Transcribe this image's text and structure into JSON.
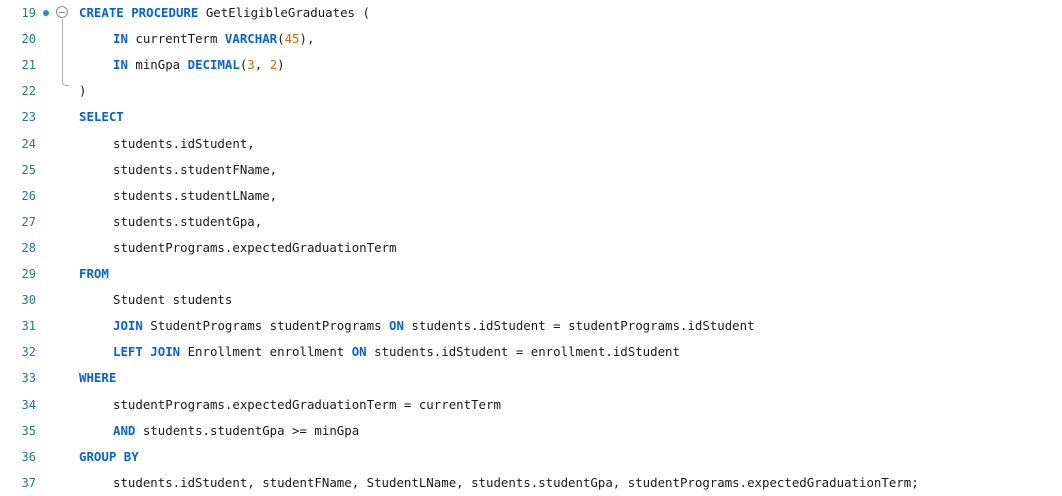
{
  "editor": {
    "colors": {
      "keyword": "#0a64c8",
      "number": "#c86e00",
      "line_number": "#237893",
      "breakpoint_dot": "#1e90c8"
    },
    "lines": [
      {
        "n": "19",
        "indent": 0,
        "tokens": [
          [
            "kw",
            "CREATE PROCEDURE"
          ],
          [
            "id",
            " GetEligibleGraduates ("
          ]
        ]
      },
      {
        "n": "20",
        "indent": 1,
        "tokens": [
          [
            "kw",
            "IN"
          ],
          [
            "id",
            " currentTerm "
          ],
          [
            "ty",
            "VARCHAR"
          ],
          [
            "id",
            "("
          ],
          [
            "num",
            "45"
          ],
          [
            "id",
            "),"
          ]
        ]
      },
      {
        "n": "21",
        "indent": 1,
        "tokens": [
          [
            "kw",
            "IN"
          ],
          [
            "id",
            " minGpa "
          ],
          [
            "ty",
            "DECIMAL"
          ],
          [
            "id",
            "("
          ],
          [
            "num",
            "3"
          ],
          [
            "id",
            ", "
          ],
          [
            "num",
            "2"
          ],
          [
            "id",
            ")"
          ]
        ]
      },
      {
        "n": "22",
        "indent": 0,
        "tokens": [
          [
            "id",
            ")"
          ]
        ]
      },
      {
        "n": "23",
        "indent": 0,
        "tokens": [
          [
            "kw",
            "SELECT"
          ]
        ]
      },
      {
        "n": "24",
        "indent": 1,
        "tokens": [
          [
            "id",
            "students.idStudent,"
          ]
        ]
      },
      {
        "n": "25",
        "indent": 1,
        "tokens": [
          [
            "id",
            "students.studentFName,"
          ]
        ]
      },
      {
        "n": "26",
        "indent": 1,
        "tokens": [
          [
            "id",
            "students.studentLName,"
          ]
        ]
      },
      {
        "n": "27",
        "indent": 1,
        "tokens": [
          [
            "id",
            "students.studentGpa,"
          ]
        ]
      },
      {
        "n": "28",
        "indent": 1,
        "tokens": [
          [
            "id",
            "studentPrograms.expectedGraduationTerm"
          ]
        ]
      },
      {
        "n": "29",
        "indent": 0,
        "tokens": [
          [
            "kw",
            "FROM"
          ]
        ]
      },
      {
        "n": "30",
        "indent": 1,
        "tokens": [
          [
            "id",
            "Student students"
          ]
        ]
      },
      {
        "n": "31",
        "indent": 1,
        "tokens": [
          [
            "kw",
            "JOIN"
          ],
          [
            "id",
            " StudentPrograms studentPrograms "
          ],
          [
            "kw",
            "ON"
          ],
          [
            "id",
            " students.idStudent = studentPrograms.idStudent"
          ]
        ]
      },
      {
        "n": "32",
        "indent": 1,
        "tokens": [
          [
            "kw",
            "LEFT JOIN"
          ],
          [
            "id",
            " Enrollment enrollment "
          ],
          [
            "kw",
            "ON"
          ],
          [
            "id",
            " students.idStudent = enrollment.idStudent"
          ]
        ]
      },
      {
        "n": "33",
        "indent": 0,
        "tokens": [
          [
            "kw",
            "WHERE"
          ]
        ]
      },
      {
        "n": "34",
        "indent": 1,
        "tokens": [
          [
            "id",
            "studentPrograms.expectedGraduationTerm = currentTerm"
          ]
        ]
      },
      {
        "n": "35",
        "indent": 1,
        "tokens": [
          [
            "kw",
            "AND"
          ],
          [
            "id",
            " students.studentGpa >= minGpa"
          ]
        ]
      },
      {
        "n": "36",
        "indent": 0,
        "tokens": [
          [
            "kw",
            "GROUP BY"
          ]
        ]
      },
      {
        "n": "37",
        "indent": 1,
        "tokens": [
          [
            "id",
            "students.idStudent, studentFName, StudentLName, students.studentGpa, studentPrograms.expectedGraduationTerm;"
          ]
        ]
      }
    ]
  }
}
